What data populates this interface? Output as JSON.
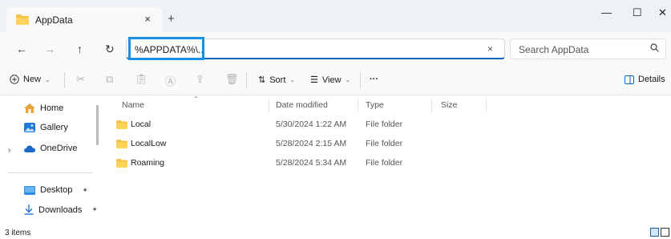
{
  "window": {
    "tab_title": "AppData",
    "tab_close": "×",
    "new_tab": "+",
    "minimize": "—",
    "maximize": "☐",
    "close": "✕"
  },
  "nav": {
    "back": "←",
    "forward": "→",
    "up": "↑",
    "refresh": "↻"
  },
  "address": {
    "value": "%APPDATA%\\..",
    "clear": "×"
  },
  "search": {
    "placeholder": "Search AppData",
    "icon": "⌕"
  },
  "toolbar": {
    "new_label": "New",
    "sort_label": "Sort",
    "view_label": "View",
    "more_label": "···",
    "details_label": "Details"
  },
  "sidebar": {
    "items": [
      {
        "label": "Home",
        "icon": "home-icon"
      },
      {
        "label": "Gallery",
        "icon": "gallery-icon"
      },
      {
        "label": "OneDrive",
        "icon": "cloud-icon"
      },
      {
        "label": "Desktop",
        "icon": "desktop-icon",
        "pinned": true
      },
      {
        "label": "Downloads",
        "icon": "download-icon",
        "pinned": true
      }
    ]
  },
  "columns": {
    "name": "Name",
    "date_modified": "Date modified",
    "type": "Type",
    "size": "Size"
  },
  "files": [
    {
      "name": "Local",
      "date": "5/30/2024 1:22 AM",
      "type": "File folder",
      "size": ""
    },
    {
      "name": "LocalLow",
      "date": "5/28/2024 2:15 AM",
      "type": "File folder",
      "size": ""
    },
    {
      "name": "Roaming",
      "date": "5/28/2024 5:34 AM",
      "type": "File folder",
      "size": ""
    }
  ],
  "status": {
    "item_count": "3 items"
  },
  "colors": {
    "accent": "#0067c0",
    "highlight_box": "#1a8fe3",
    "folder": "#f4c245"
  }
}
